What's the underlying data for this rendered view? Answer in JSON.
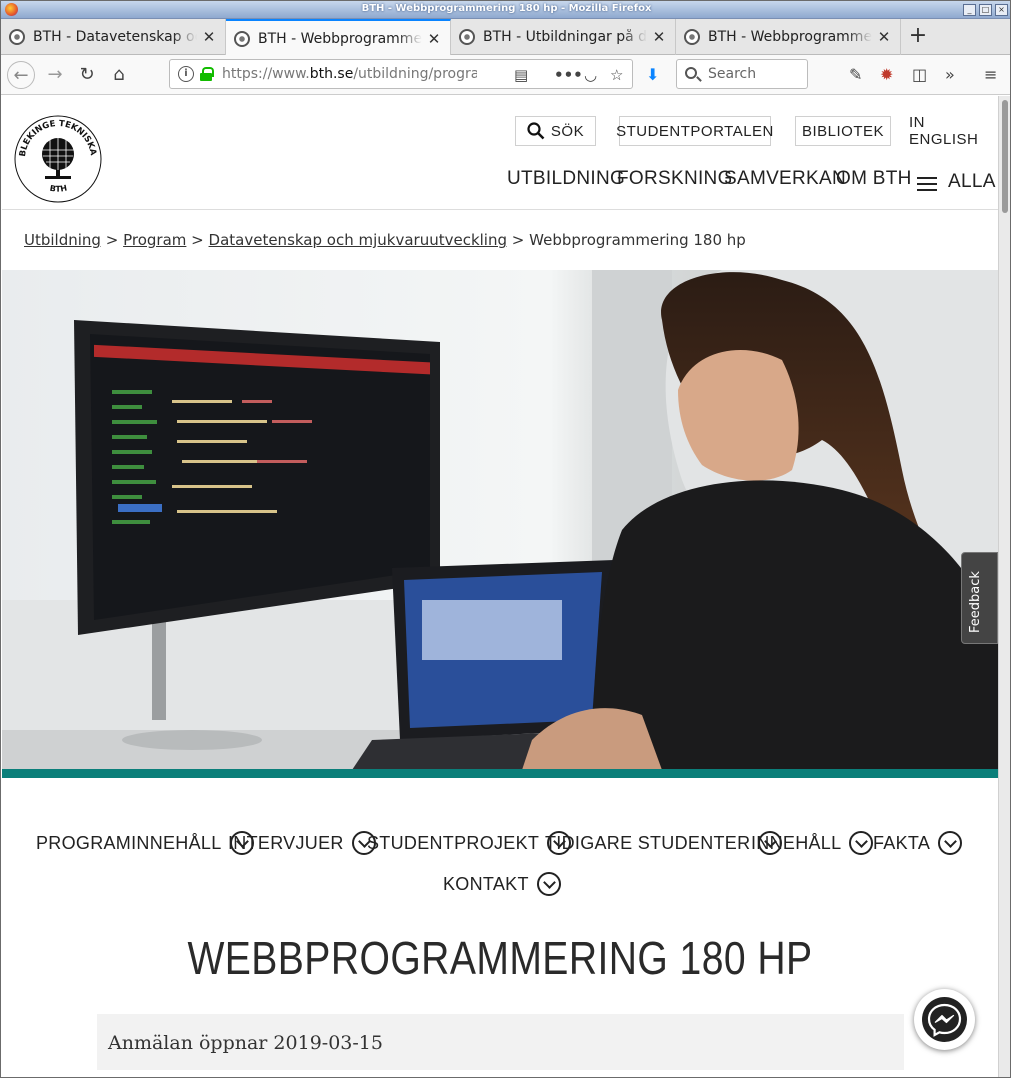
{
  "window": {
    "title": "BTH - Webbprogrammering 180 hp - Mozilla Firefox",
    "controls": [
      "_",
      "□",
      "×"
    ]
  },
  "tabs": [
    {
      "label": "BTH - Datavetenskap och"
    },
    {
      "label": "BTH - Webbprogrammering"
    },
    {
      "label": "BTH - Utbildningar på dis"
    },
    {
      "label": "BTH - Webbprogrammering"
    }
  ],
  "toolbar": {
    "url_prefix": "https://www.",
    "url_domain": "bth.se",
    "url_path": "/utbildning/program/",
    "search_placeholder": "Search"
  },
  "header": {
    "search_label": "SÖK",
    "studentportal": "STUDENTPORTALEN",
    "library": "BIBLIOTEK",
    "english": "IN ENGLISH",
    "nav": [
      "UTBILDNING",
      "FORSKNING",
      "SAMVERKAN",
      "OM BTH",
      "ALLA"
    ],
    "logo_text": "BLEKINGE TEKNISKA HÖGSKOLA · BTH"
  },
  "breadcrumb": {
    "items": [
      "Utbildning",
      "Program",
      "Datavetenskap och mjukvaruutveckling"
    ],
    "separator": ">",
    "current": "Webbprogrammering 180 hp"
  },
  "feedback_label": "Feedback",
  "subnav": [
    "PROGRAMINNEHÅLL",
    "INTERVJUER",
    "STUDENTPROJEKT",
    "TIDIGARE STUDENTER",
    "INNEHÅLL",
    "FAKTA",
    "KONTAKT"
  ],
  "page_title": "WEBBPROGRAMMERING 180 HP",
  "info_text": "Anmälan öppnar 2019-03-15",
  "colors": {
    "accent": "#0b7f7a",
    "text": "#222222"
  }
}
